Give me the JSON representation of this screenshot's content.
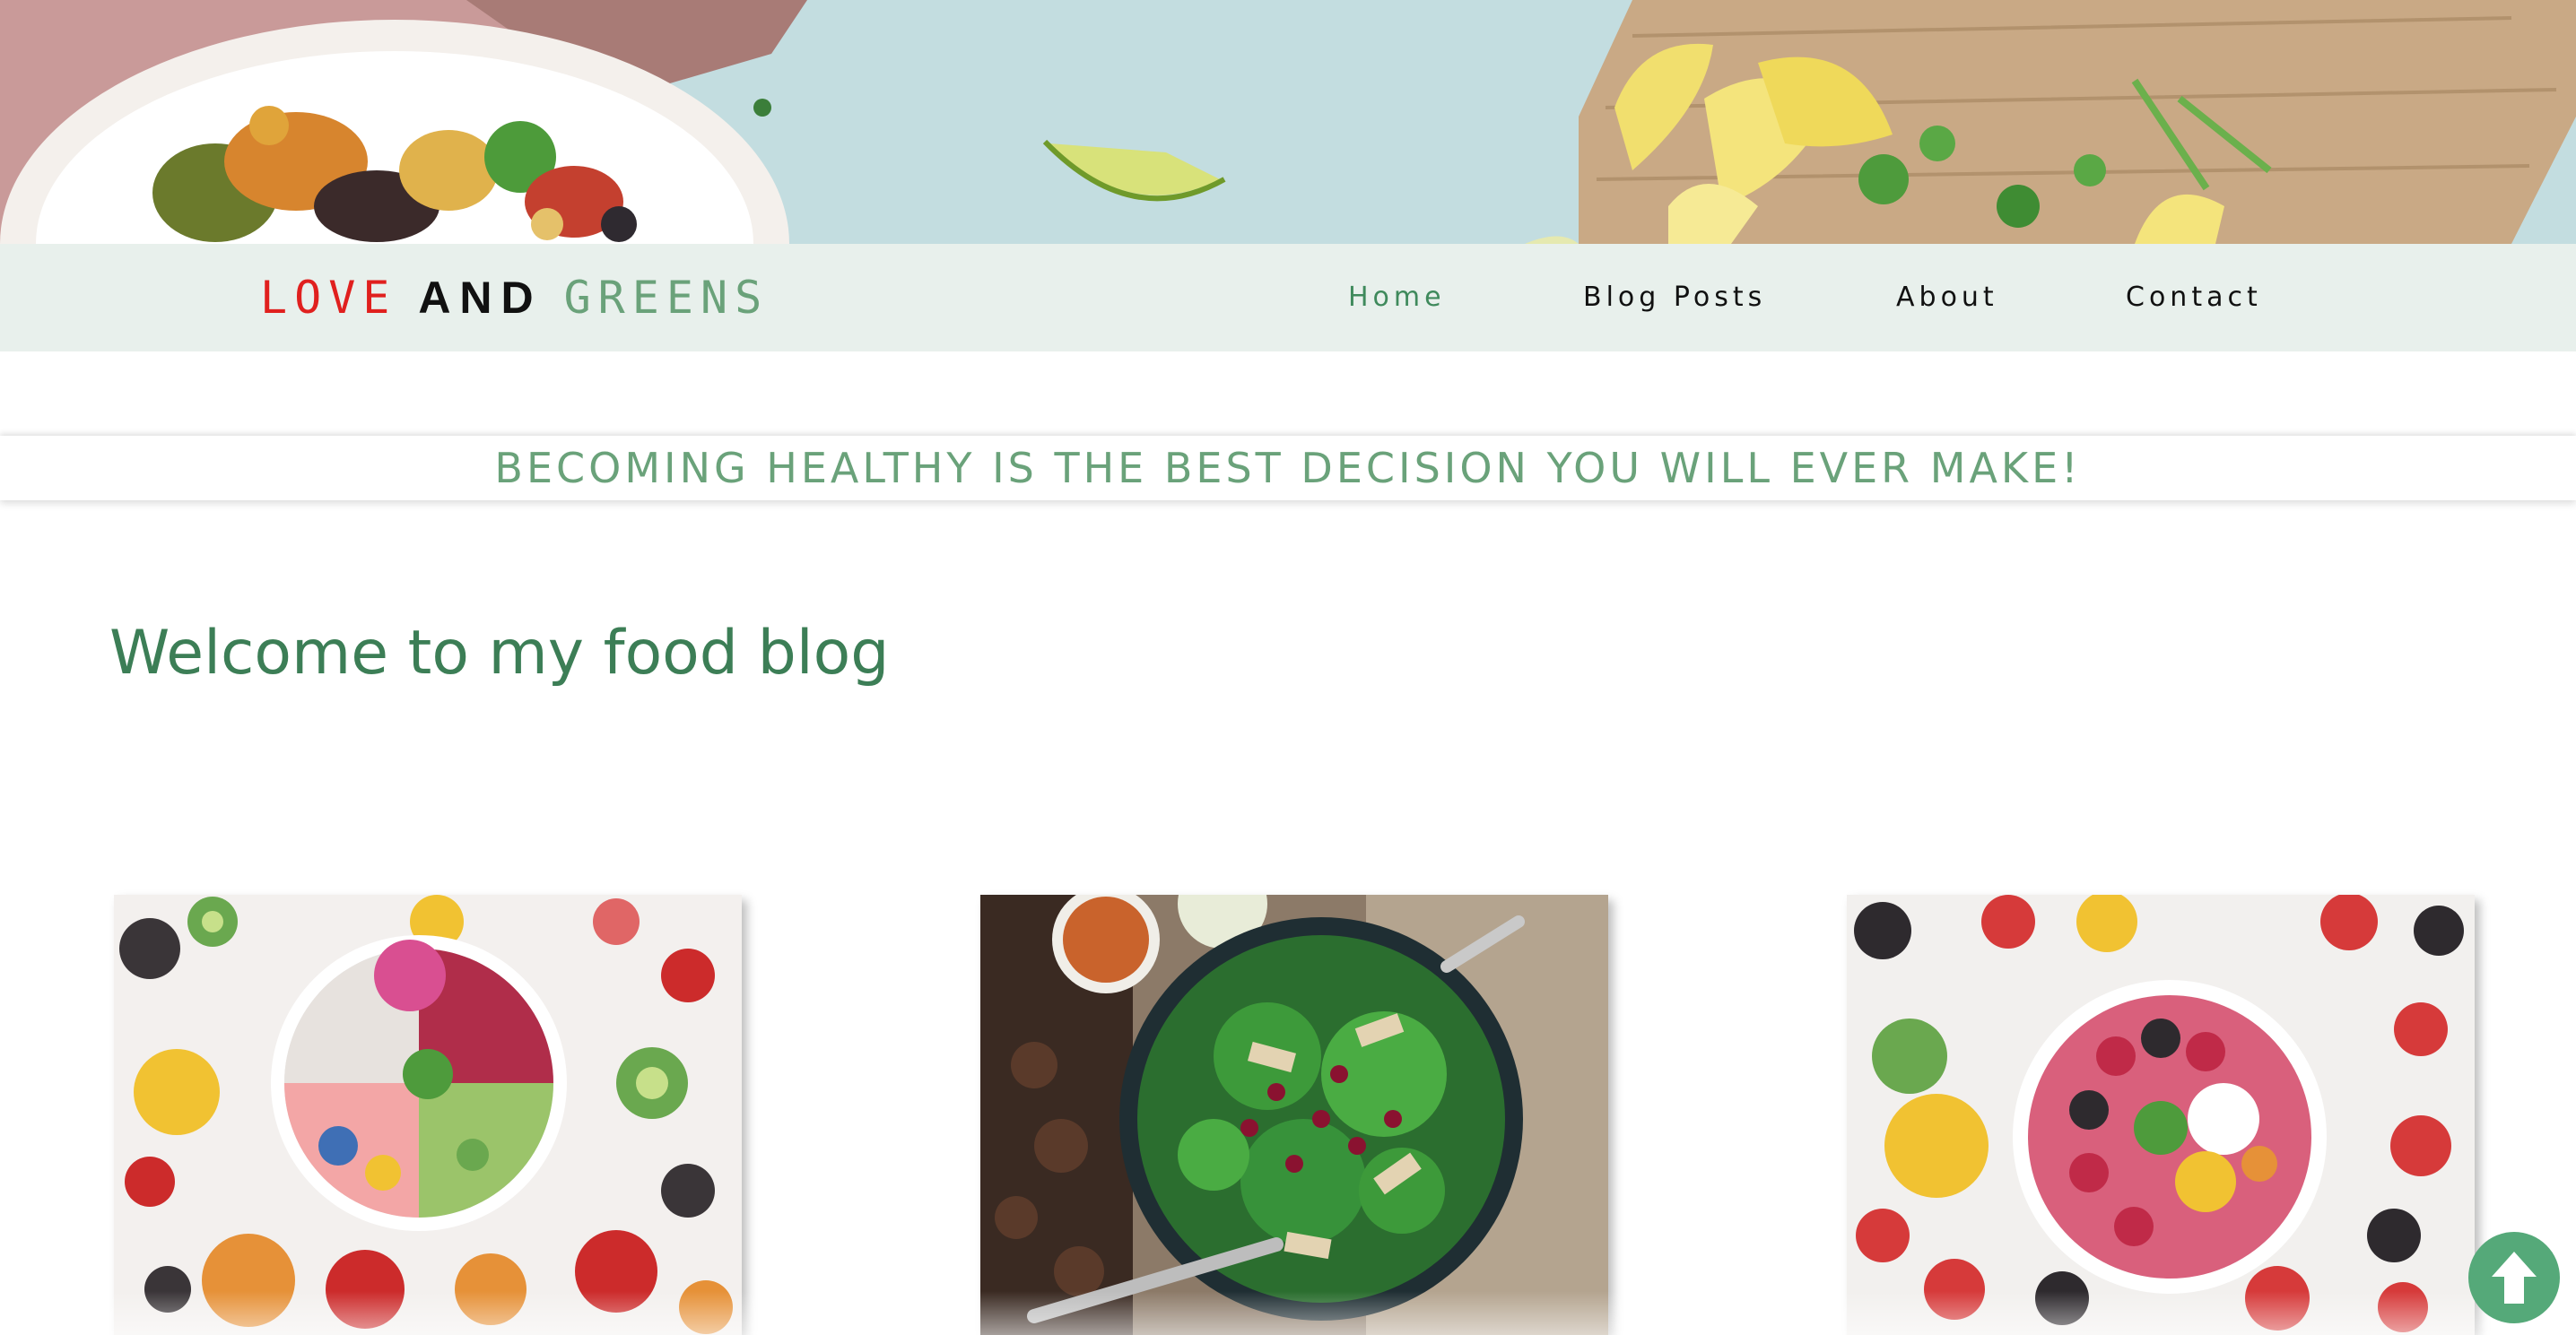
{
  "colors": {
    "logo_love": "#e0201e",
    "logo_and": "#111111",
    "logo_greens": "#6aa27a",
    "nav_background": "#e8f0ec",
    "nav_active": "#3f8a5c",
    "accent_green": "#6aa27a",
    "heading_green": "#3c7e56",
    "back_to_top": "#55a979"
  },
  "hero": {
    "image": "food-banner-image"
  },
  "logo": {
    "word1": "LOVE",
    "word2": "AND",
    "word3": "GREENS"
  },
  "nav": {
    "items": [
      {
        "label": "Home",
        "active": true
      },
      {
        "label": "Blog Posts",
        "active": false
      },
      {
        "label": "About",
        "active": false
      },
      {
        "label": "Contact",
        "active": false
      }
    ]
  },
  "tagline": "BECOMING HEALTHY IS THE BEST DECISION YOU WILL EVER MAKE!",
  "main": {
    "heading": "Welcome to my food blog",
    "cards": [
      {
        "image": "fruit-smoothie-bowl-image"
      },
      {
        "image": "spinach-pomegranate-salad-image"
      },
      {
        "image": "berry-smoothie-bowl-image"
      }
    ]
  },
  "back_to_top": {
    "icon": "arrow-up-icon"
  }
}
